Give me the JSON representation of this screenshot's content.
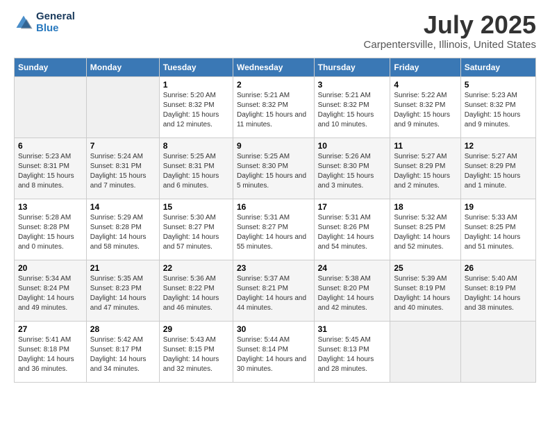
{
  "logo": {
    "line1": "General",
    "line2": "Blue"
  },
  "title": "July 2025",
  "subtitle": "Carpentersville, Illinois, United States",
  "days_of_week": [
    "Sunday",
    "Monday",
    "Tuesday",
    "Wednesday",
    "Thursday",
    "Friday",
    "Saturday"
  ],
  "weeks": [
    [
      {
        "day": "",
        "detail": ""
      },
      {
        "day": "",
        "detail": ""
      },
      {
        "day": "1",
        "detail": "Sunrise: 5:20 AM\nSunset: 8:32 PM\nDaylight: 15 hours and 12 minutes."
      },
      {
        "day": "2",
        "detail": "Sunrise: 5:21 AM\nSunset: 8:32 PM\nDaylight: 15 hours and 11 minutes."
      },
      {
        "day": "3",
        "detail": "Sunrise: 5:21 AM\nSunset: 8:32 PM\nDaylight: 15 hours and 10 minutes."
      },
      {
        "day": "4",
        "detail": "Sunrise: 5:22 AM\nSunset: 8:32 PM\nDaylight: 15 hours and 9 minutes."
      },
      {
        "day": "5",
        "detail": "Sunrise: 5:23 AM\nSunset: 8:32 PM\nDaylight: 15 hours and 9 minutes."
      }
    ],
    [
      {
        "day": "6",
        "detail": "Sunrise: 5:23 AM\nSunset: 8:31 PM\nDaylight: 15 hours and 8 minutes."
      },
      {
        "day": "7",
        "detail": "Sunrise: 5:24 AM\nSunset: 8:31 PM\nDaylight: 15 hours and 7 minutes."
      },
      {
        "day": "8",
        "detail": "Sunrise: 5:25 AM\nSunset: 8:31 PM\nDaylight: 15 hours and 6 minutes."
      },
      {
        "day": "9",
        "detail": "Sunrise: 5:25 AM\nSunset: 8:30 PM\nDaylight: 15 hours and 5 minutes."
      },
      {
        "day": "10",
        "detail": "Sunrise: 5:26 AM\nSunset: 8:30 PM\nDaylight: 15 hours and 3 minutes."
      },
      {
        "day": "11",
        "detail": "Sunrise: 5:27 AM\nSunset: 8:29 PM\nDaylight: 15 hours and 2 minutes."
      },
      {
        "day": "12",
        "detail": "Sunrise: 5:27 AM\nSunset: 8:29 PM\nDaylight: 15 hours and 1 minute."
      }
    ],
    [
      {
        "day": "13",
        "detail": "Sunrise: 5:28 AM\nSunset: 8:28 PM\nDaylight: 15 hours and 0 minutes."
      },
      {
        "day": "14",
        "detail": "Sunrise: 5:29 AM\nSunset: 8:28 PM\nDaylight: 14 hours and 58 minutes."
      },
      {
        "day": "15",
        "detail": "Sunrise: 5:30 AM\nSunset: 8:27 PM\nDaylight: 14 hours and 57 minutes."
      },
      {
        "day": "16",
        "detail": "Sunrise: 5:31 AM\nSunset: 8:27 PM\nDaylight: 14 hours and 55 minutes."
      },
      {
        "day": "17",
        "detail": "Sunrise: 5:31 AM\nSunset: 8:26 PM\nDaylight: 14 hours and 54 minutes."
      },
      {
        "day": "18",
        "detail": "Sunrise: 5:32 AM\nSunset: 8:25 PM\nDaylight: 14 hours and 52 minutes."
      },
      {
        "day": "19",
        "detail": "Sunrise: 5:33 AM\nSunset: 8:25 PM\nDaylight: 14 hours and 51 minutes."
      }
    ],
    [
      {
        "day": "20",
        "detail": "Sunrise: 5:34 AM\nSunset: 8:24 PM\nDaylight: 14 hours and 49 minutes."
      },
      {
        "day": "21",
        "detail": "Sunrise: 5:35 AM\nSunset: 8:23 PM\nDaylight: 14 hours and 47 minutes."
      },
      {
        "day": "22",
        "detail": "Sunrise: 5:36 AM\nSunset: 8:22 PM\nDaylight: 14 hours and 46 minutes."
      },
      {
        "day": "23",
        "detail": "Sunrise: 5:37 AM\nSunset: 8:21 PM\nDaylight: 14 hours and 44 minutes."
      },
      {
        "day": "24",
        "detail": "Sunrise: 5:38 AM\nSunset: 8:20 PM\nDaylight: 14 hours and 42 minutes."
      },
      {
        "day": "25",
        "detail": "Sunrise: 5:39 AM\nSunset: 8:19 PM\nDaylight: 14 hours and 40 minutes."
      },
      {
        "day": "26",
        "detail": "Sunrise: 5:40 AM\nSunset: 8:19 PM\nDaylight: 14 hours and 38 minutes."
      }
    ],
    [
      {
        "day": "27",
        "detail": "Sunrise: 5:41 AM\nSunset: 8:18 PM\nDaylight: 14 hours and 36 minutes."
      },
      {
        "day": "28",
        "detail": "Sunrise: 5:42 AM\nSunset: 8:17 PM\nDaylight: 14 hours and 34 minutes."
      },
      {
        "day": "29",
        "detail": "Sunrise: 5:43 AM\nSunset: 8:15 PM\nDaylight: 14 hours and 32 minutes."
      },
      {
        "day": "30",
        "detail": "Sunrise: 5:44 AM\nSunset: 8:14 PM\nDaylight: 14 hours and 30 minutes."
      },
      {
        "day": "31",
        "detail": "Sunrise: 5:45 AM\nSunset: 8:13 PM\nDaylight: 14 hours and 28 minutes."
      },
      {
        "day": "",
        "detail": ""
      },
      {
        "day": "",
        "detail": ""
      }
    ]
  ]
}
